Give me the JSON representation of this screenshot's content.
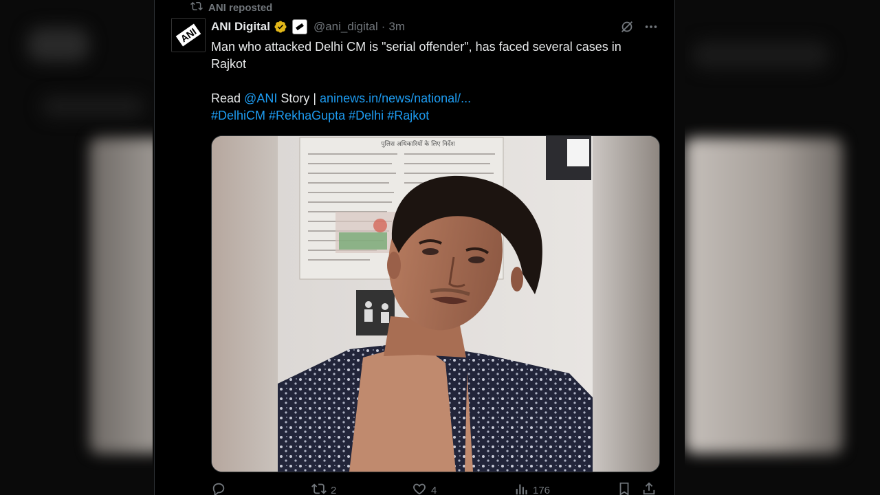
{
  "repost": {
    "label": "ANI reposted"
  },
  "author": {
    "display_name": "ANI Digital",
    "handle": "@ani_digital",
    "separator": "·",
    "time": "3m",
    "avatar_text": "ANI"
  },
  "tweet": {
    "line1": "Man who attacked Delhi CM is \"serial offender\", has faced several cases in",
    "line2": "Rajkot",
    "read_prefix": "Read ",
    "mention": "@ANI",
    "story_suffix": " Story | ",
    "url": "aninews.in/news/national/...",
    "hashtags": [
      "#DelhiCM",
      "#RekhaGupta",
      "#Delhi",
      "#Rajkot"
    ]
  },
  "media": {
    "poster_title": "पुलिस अधिकारियों के लिए निर्देश"
  },
  "actions": {
    "reply_count": "",
    "repost_count": "2",
    "like_count": "4",
    "views_count": "176"
  },
  "colors": {
    "accent": "#1d9bf0",
    "verified_gold": "#e2b719",
    "text": "#e7e9ea",
    "muted": "#71767b"
  }
}
